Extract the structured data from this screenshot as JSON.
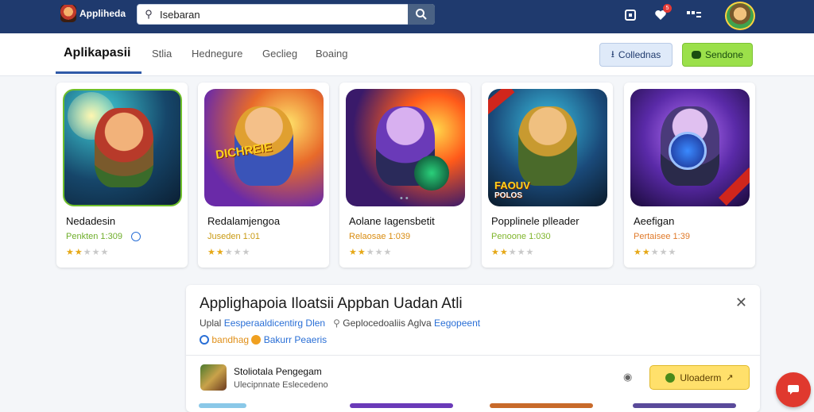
{
  "header": {
    "logo_text": "Appliheda",
    "search": {
      "value": "Isebaran",
      "placeholder": ""
    },
    "notification_count": "5"
  },
  "nav": {
    "tabs": [
      {
        "label": "Aplikapasii"
      },
      {
        "label": "Stlia"
      },
      {
        "label": "Hednegure"
      },
      {
        "label": "Geclieg"
      },
      {
        "label": "Boaing"
      }
    ],
    "blue_button": "Collednas",
    "green_button": "Sendone"
  },
  "apps": [
    {
      "title": "Nedadesin",
      "subtitle": "Penkten 1:309",
      "subtitle_color": "#6fae2b",
      "rating": 2
    },
    {
      "title": "Redalamjengoa",
      "subtitle": "Juseden 1:01",
      "subtitle_color": "#c99a12",
      "rating": 2
    },
    {
      "title": "Aolane Iagensbetit",
      "subtitle": "Relaosae 1:039",
      "subtitle_color": "#d98c10",
      "rating": 2,
      "art_overlay": "• •"
    },
    {
      "title": "Popplinele plleader",
      "subtitle": "Penoone 1:030",
      "subtitle_color": "#7fb52b",
      "rating": 2,
      "art_ribbon": "FAOUV",
      "art_sub": "POLOS"
    },
    {
      "title": "Aeefigan",
      "subtitle": "Pertaisee 1:39",
      "subtitle_color": "#e07a2a",
      "rating": 2
    }
  ],
  "panel": {
    "title": "Applighapoia Iloatsii Appban Uadan Atli",
    "row1": {
      "label": "Uplal",
      "link": "Eesperaaldicentirg Dlen",
      "meta": "Geplocedoaliis Aglva",
      "meta_link": "Eegopeent"
    },
    "row2": {
      "tag1": "bandhag",
      "tag2": "Bakurr Peaeris"
    },
    "item": {
      "title": "Stoliotala Pengegam",
      "subtitle": "Ulecipnnate Eslecedeno",
      "button": "Uloaderm"
    }
  },
  "colors": {
    "topbar": "#1f3a6e",
    "accent": "#2f5aa8",
    "green": "#9be04a",
    "yellow": "#ffe06b",
    "fab": "#e0392e"
  }
}
